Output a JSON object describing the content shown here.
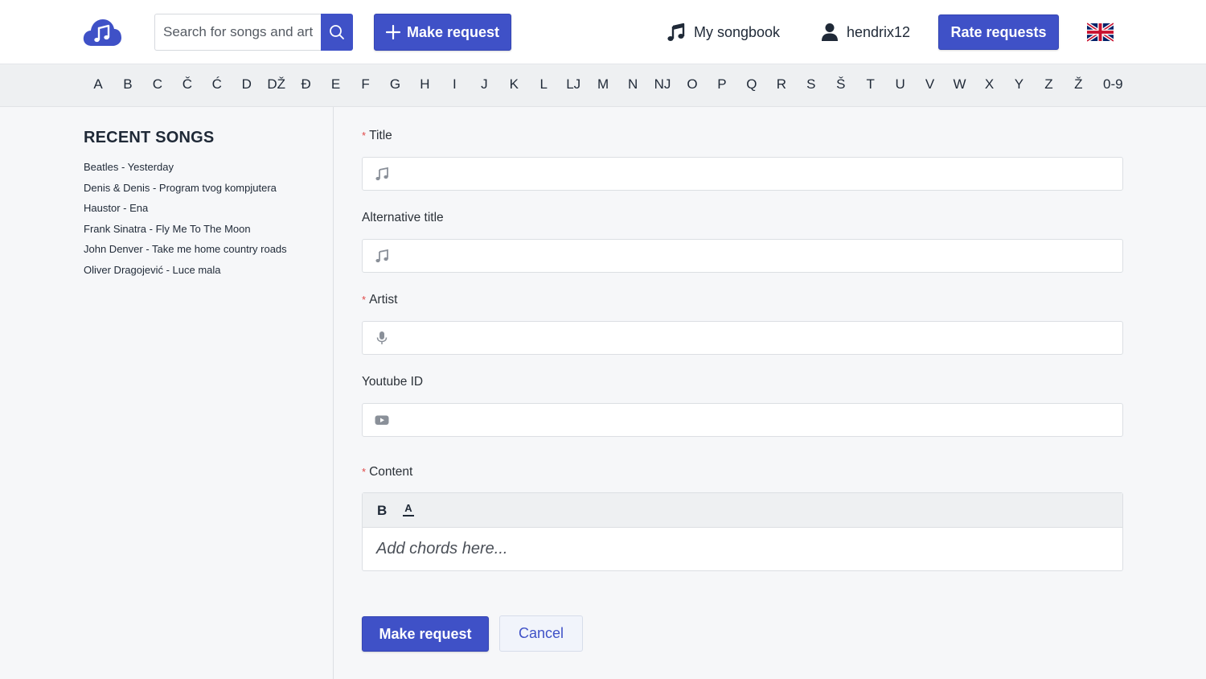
{
  "header": {
    "logo_icon": "cloud-music-icon",
    "search": {
      "placeholder": "Search for songs and artists",
      "value": ""
    },
    "make_request_label": "Make request",
    "songbook_label": "My songbook",
    "username": "hendrix12",
    "rate_requests_label": "Rate requests",
    "language_icon": "uk-flag-icon"
  },
  "alphabet": [
    "A",
    "B",
    "C",
    "Č",
    "Ć",
    "D",
    "DŽ",
    "Đ",
    "E",
    "F",
    "G",
    "H",
    "I",
    "J",
    "K",
    "L",
    "LJ",
    "M",
    "N",
    "NJ",
    "O",
    "P",
    "Q",
    "R",
    "S",
    "Š",
    "T",
    "U",
    "V",
    "W",
    "X",
    "Y",
    "Z",
    "Ž",
    "0-9"
  ],
  "sidebar": {
    "title": "RECENT SONGS",
    "songs": [
      "Beatles - Yesterday",
      "Denis & Denis - Program tvog kompjutera",
      "Haustor - Ena",
      "Frank Sinatra - Fly Me To The Moon",
      "John Denver - Take me home country roads",
      "Oliver Dragojević - Luce mala"
    ]
  },
  "form": {
    "required_mark": "*",
    "title": {
      "label": "Title",
      "value": ""
    },
    "alt_title": {
      "label": "Alternative title",
      "value": ""
    },
    "artist": {
      "label": "Artist",
      "value": ""
    },
    "youtube": {
      "label": "Youtube ID",
      "value": ""
    },
    "content": {
      "label": "Content",
      "bold_label": "B",
      "color_label": "A",
      "placeholder": "Add chords here..."
    },
    "submit_label": "Make request",
    "cancel_label": "Cancel"
  },
  "colors": {
    "primary": "#3f51c7",
    "required": "#e04848",
    "background": "#f6f7f9"
  }
}
